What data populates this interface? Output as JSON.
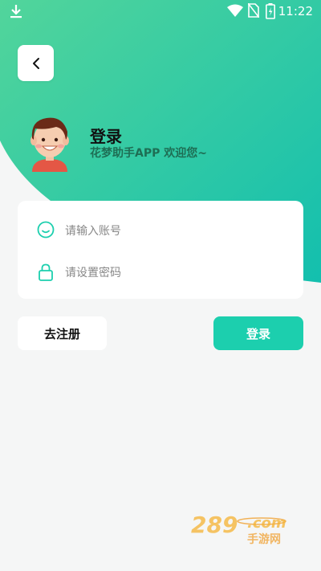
{
  "status_bar": {
    "time": "11:22"
  },
  "header": {
    "title": "登录",
    "subtitle": "花梦助手APP 欢迎您~"
  },
  "form": {
    "account_placeholder": "请输入账号",
    "password_placeholder": "请设置密码"
  },
  "buttons": {
    "register_label": "去注册",
    "login_label": "登录"
  },
  "watermark": {
    "text": "289.com",
    "subtext": "手游网"
  },
  "colors": {
    "accent": "#1ccfae",
    "gradient_start": "#46d2a2",
    "gradient_end": "#16c0b0"
  },
  "icons": [
    "download-icon",
    "wifi-icon",
    "no-sim-icon",
    "battery-icon",
    "back-arrow-icon",
    "user-smile-icon",
    "lock-icon"
  ]
}
